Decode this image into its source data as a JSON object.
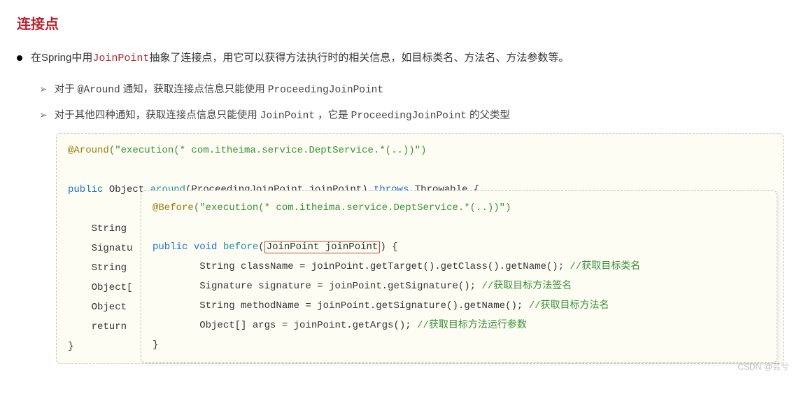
{
  "title": "连接点",
  "main": {
    "pre": "在Spring中用",
    "highlight": "JoinPoint",
    "post": "抽象了连接点，用它可以获得方法执行时的相关信息，如目标类名、方法名、方法参数等。"
  },
  "subs": [
    {
      "pre": "对于 ",
      "mono": "@Around",
      "mid": " 通知，获取连接点信息只能使用   ",
      "mono2": "ProceedingJoinPoint"
    },
    {
      "pre": "对于其他四种通知，获取连接点信息只能使用 ",
      "mono": "JoinPoint",
      "mid": " ，它是 ",
      "mono2": "ProceedingJoinPoint",
      "tail": " 的父类型"
    }
  ],
  "code_outer": {
    "ann": "@Around",
    "annarg": "(\"execution(* com.itheima.service.DeptService.*(..))\")",
    "sig_pre": "public",
    "sig_type": "Object",
    "sig_name": "around",
    "sig_params": "(ProceedingJoinPoint joinPoint)",
    "throws_kw": "throws",
    "throws_t": "Throwable",
    "l_string": "    String ",
    "l_signat": "    Signatu",
    "l_string2": "    String ",
    "l_objarr": "    Object[",
    "l_object": "    Object ",
    "l_return": "    return ",
    "close": "}"
  },
  "code_inner": {
    "ann": "@Before",
    "annarg": "(\"execution(* com.itheima.service.DeptService.*(..))\")",
    "sig_pre": "public",
    "sig_void": "void",
    "sig_name": "before",
    "sig_params": "JoinPoint joinPoint",
    "body1": "        String className = joinPoint.getTarget().getClass().getName(); ",
    "c1": "//获取目标类名",
    "body2": "        Signature signature = joinPoint.getSignature(); ",
    "c2": "//获取目标方法签名",
    "body3": "        String methodName = joinPoint.getSignature().getName(); ",
    "c3": "//获取目标方法名",
    "body4": "        Object[] args = joinPoint.getArgs(); ",
    "c4": "//获取目标方法运行参数",
    "close": "}"
  },
  "watermark": "CSDN @芸兮"
}
